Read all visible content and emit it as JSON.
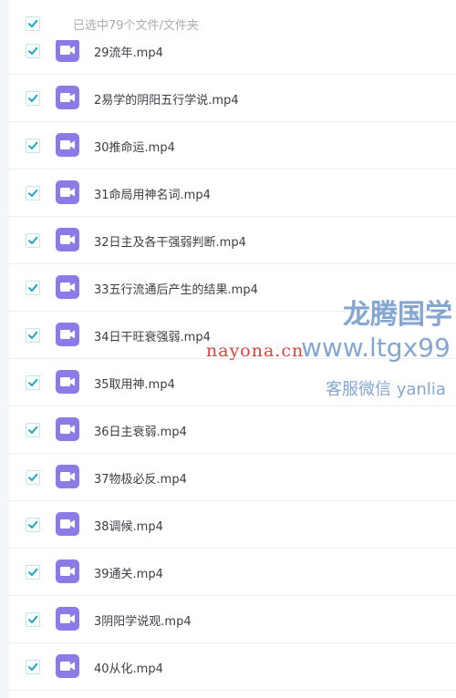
{
  "header": {
    "selection_summary": "已选中79个文件/文件夹",
    "select_all_checked": true
  },
  "files": [
    {
      "name": "29流年.mp4",
      "checked": true
    },
    {
      "name": "2易学的阴阳五行学说.mp4",
      "checked": true
    },
    {
      "name": "30推命运.mp4",
      "checked": true
    },
    {
      "name": "31命局用神名词.mp4",
      "checked": true
    },
    {
      "name": "32日主及各干强弱判断.mp4",
      "checked": true
    },
    {
      "name": "33五行流通后产生的结果.mp4",
      "checked": true
    },
    {
      "name": "34日干旺衰强弱.mp4",
      "checked": true
    },
    {
      "name": "35取用神.mp4",
      "checked": true
    },
    {
      "name": "36日主衰弱.mp4",
      "checked": true
    },
    {
      "name": "37物极必反.mp4",
      "checked": true
    },
    {
      "name": "38调候.mp4",
      "checked": true
    },
    {
      "name": "39通关.mp4",
      "checked": true
    },
    {
      "name": "3阴阳学说观.mp4",
      "checked": true
    },
    {
      "name": "40从化.mp4",
      "checked": true
    }
  ],
  "watermark": {
    "brand": "龙腾国学",
    "url": "www.ltgx99",
    "service": "客服微信 yanlia",
    "site": "nayona.cn"
  },
  "colors": {
    "checkbox_tick": "#1aa7c7",
    "video_icon_bg": "#8a7be6",
    "watermark_blue": "#6f97c9",
    "watermark_red": "#dc2a2a"
  },
  "icons": {
    "checkbox": "check-icon",
    "file_type": "video-file-icon"
  }
}
